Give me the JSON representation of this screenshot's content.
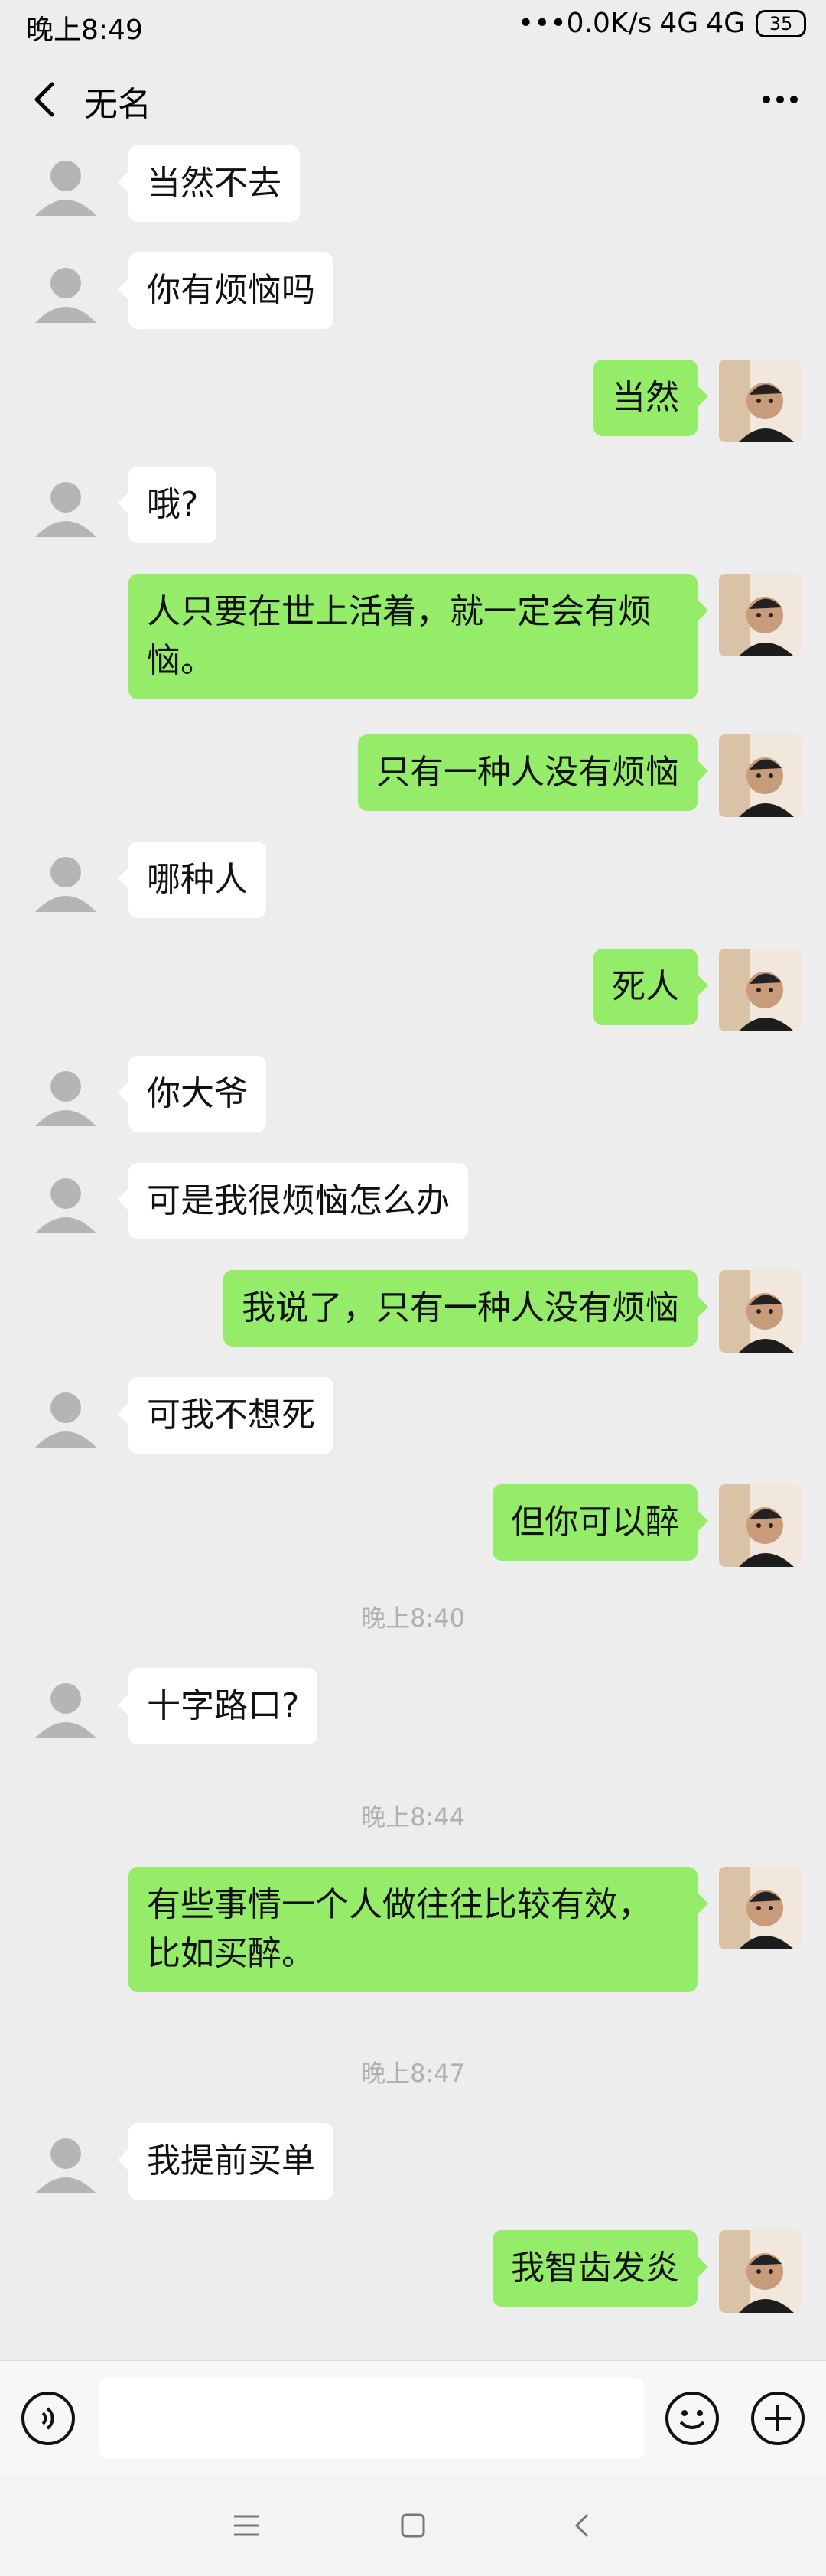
{
  "status": {
    "time": "晚上8:49",
    "network": "•••0.0K/s",
    "sig1": "4G",
    "sig2": "4G",
    "battery": "35"
  },
  "header": {
    "title": "无名"
  },
  "chat": [
    {
      "side": "in",
      "text": "当然不去"
    },
    {
      "side": "in",
      "text": "你有烦恼吗"
    },
    {
      "side": "out",
      "text": "当然"
    },
    {
      "side": "in",
      "text": "哦?"
    },
    {
      "side": "out",
      "text": "人只要在世上活着，就一定会有烦恼。"
    },
    {
      "side": "out",
      "text": "只有一种人没有烦恼"
    },
    {
      "side": "in",
      "text": "哪种人"
    },
    {
      "side": "out",
      "text": "死人"
    },
    {
      "side": "in",
      "text": "你大爷"
    },
    {
      "side": "in",
      "text": "可是我很烦恼怎么办"
    },
    {
      "side": "out",
      "text": "我说了，只有一种人没有烦恼"
    },
    {
      "side": "in",
      "text": "可我不想死"
    },
    {
      "side": "out",
      "text": "但你可以醉"
    },
    {
      "timestamp": "晚上8:40"
    },
    {
      "side": "in",
      "text": "十字路口?"
    },
    {
      "timestamp": "晚上8:44"
    },
    {
      "side": "out",
      "text": "有些事情一个人做往往比较有效，比如买醉。"
    },
    {
      "timestamp": "晚上8:47"
    },
    {
      "side": "in",
      "text": "我提前买单"
    },
    {
      "side": "out",
      "text": "我智齿发炎"
    }
  ],
  "input": {
    "placeholder": ""
  },
  "icons": {
    "back": "chevron-left-icon",
    "more": "more-icon",
    "voice": "voice-icon",
    "emoji": "emoji-icon",
    "plus": "plus-icon"
  },
  "colors": {
    "bg": "#ededed",
    "out_bubble": "#95ec69",
    "in_bubble": "#ffffff"
  }
}
